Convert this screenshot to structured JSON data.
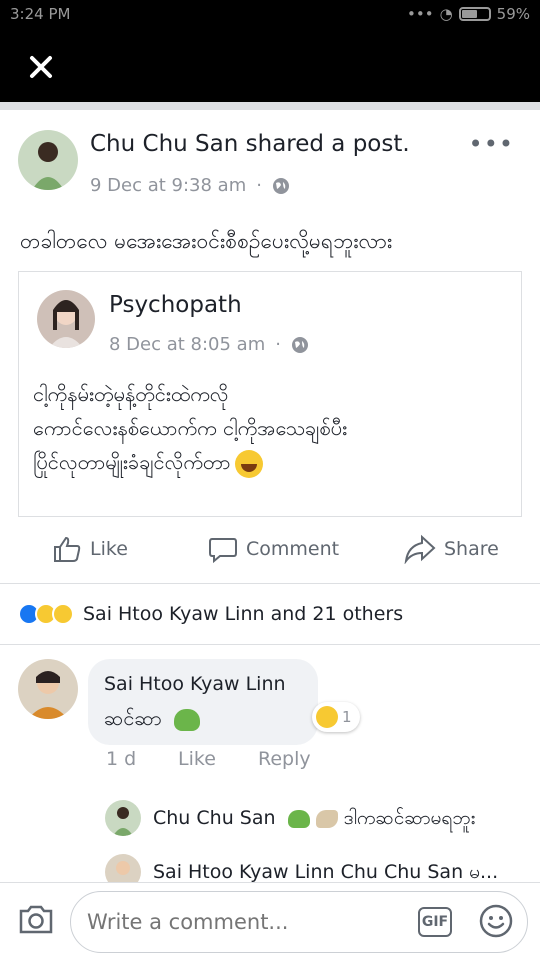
{
  "status_bar": {
    "time": "3:24 PM",
    "battery": "59%",
    "battery_level": 0.59
  },
  "post": {
    "author": "Chu Chu San shared a post.",
    "time": "9 Dec at 9:38 am",
    "text": "တခါတလေ မအေးအေးဝင်းစီစဉ်ပေးလို့မရဘူးလား"
  },
  "shared": {
    "author": "Psychopath",
    "time": "8 Dec at 8:05 am",
    "lines": [
      "ငါ့ကိုနမ်းတဲ့မုန့်တိုင်းထဲကလို",
      "ကောင်လေးနစ်ယောက်က ငါ့ကိုအသေချစ်ပီး",
      "ပြိုင်လုတာမျိုးခံချင်လိုက်တာ"
    ]
  },
  "actions": {
    "like": "Like",
    "comment": "Comment",
    "share": "Share"
  },
  "reactions_text": "Sai Htoo Kyaw Linn and 21 others",
  "comment": {
    "author": "Sai Htoo Kyaw Linn",
    "text": "ဆင်ဆာ",
    "reaction_count": "1",
    "age": "1 d",
    "like": "Like",
    "reply": "Reply"
  },
  "replies": [
    {
      "author": "Chu Chu San",
      "text": "ဒါကဆင်ဆာမရဘူး"
    },
    {
      "text": "Sai Htoo Kyaw Linn Chu Chu San မ..."
    }
  ],
  "composer": {
    "placeholder": "Write a comment...",
    "gif": "GIF"
  },
  "colors": {
    "link": "#1877f2",
    "meta": "#90949c",
    "bubble": "#f0f2f5"
  }
}
